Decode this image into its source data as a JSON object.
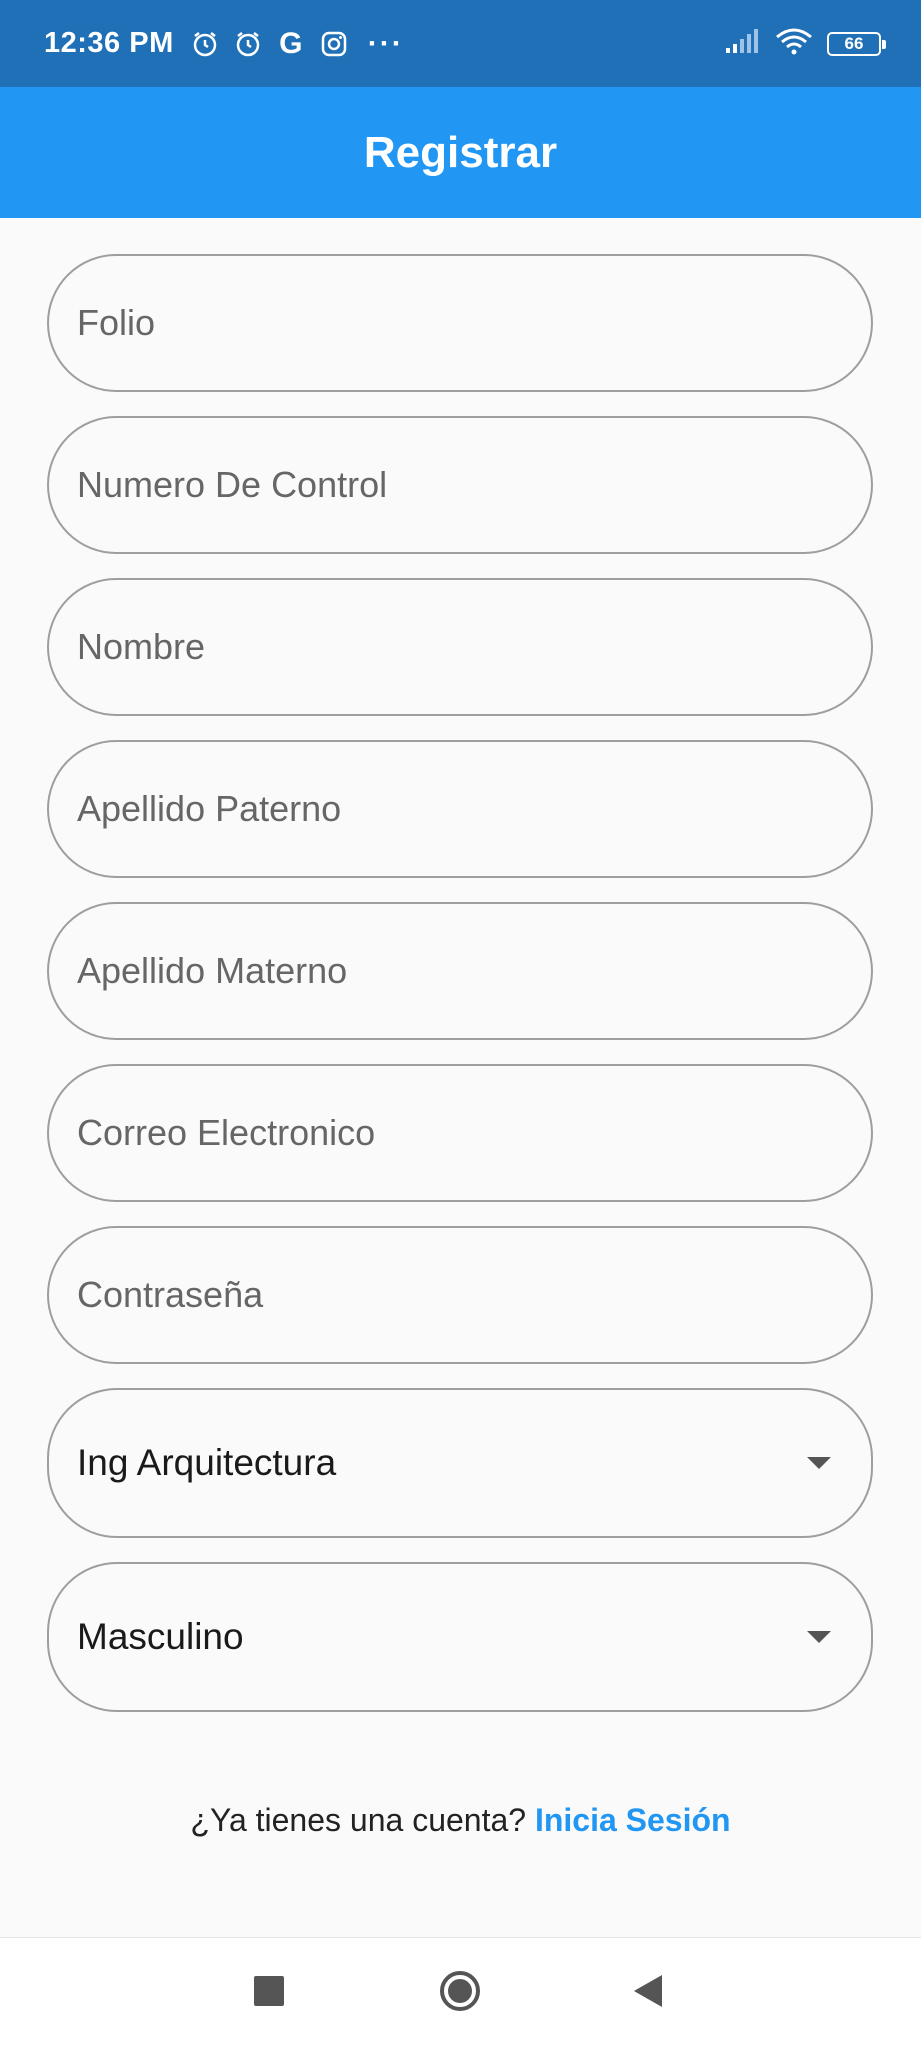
{
  "status_bar": {
    "time": "12:36 PM",
    "icons": [
      "alarm-icon",
      "alarm-icon",
      "google-icon",
      "instagram-icon",
      "more-icon",
      "signal-icon",
      "wifi-icon",
      "battery-icon"
    ],
    "g_label": "G",
    "more_label": "···",
    "battery_level": "66"
  },
  "app_bar": {
    "title": "Registrar",
    "color": "#2196f3"
  },
  "form": {
    "fields": [
      {
        "placeholder": "Folio"
      },
      {
        "placeholder": "Numero De Control"
      },
      {
        "placeholder": "Nombre"
      },
      {
        "placeholder": "Apellido Paterno"
      },
      {
        "placeholder": "Apellido Materno"
      },
      {
        "placeholder": "Correo Electronico"
      },
      {
        "placeholder": "Contraseña"
      }
    ],
    "career_select": {
      "value": "Ing Arquitectura"
    },
    "gender_select": {
      "value": "Masculino"
    }
  },
  "footer": {
    "question": "¿Ya tienes una cuenta?",
    "link": "Inicia Sesión"
  },
  "nav_bar": {
    "icons": [
      "recents-icon",
      "home-icon",
      "back-icon"
    ]
  }
}
